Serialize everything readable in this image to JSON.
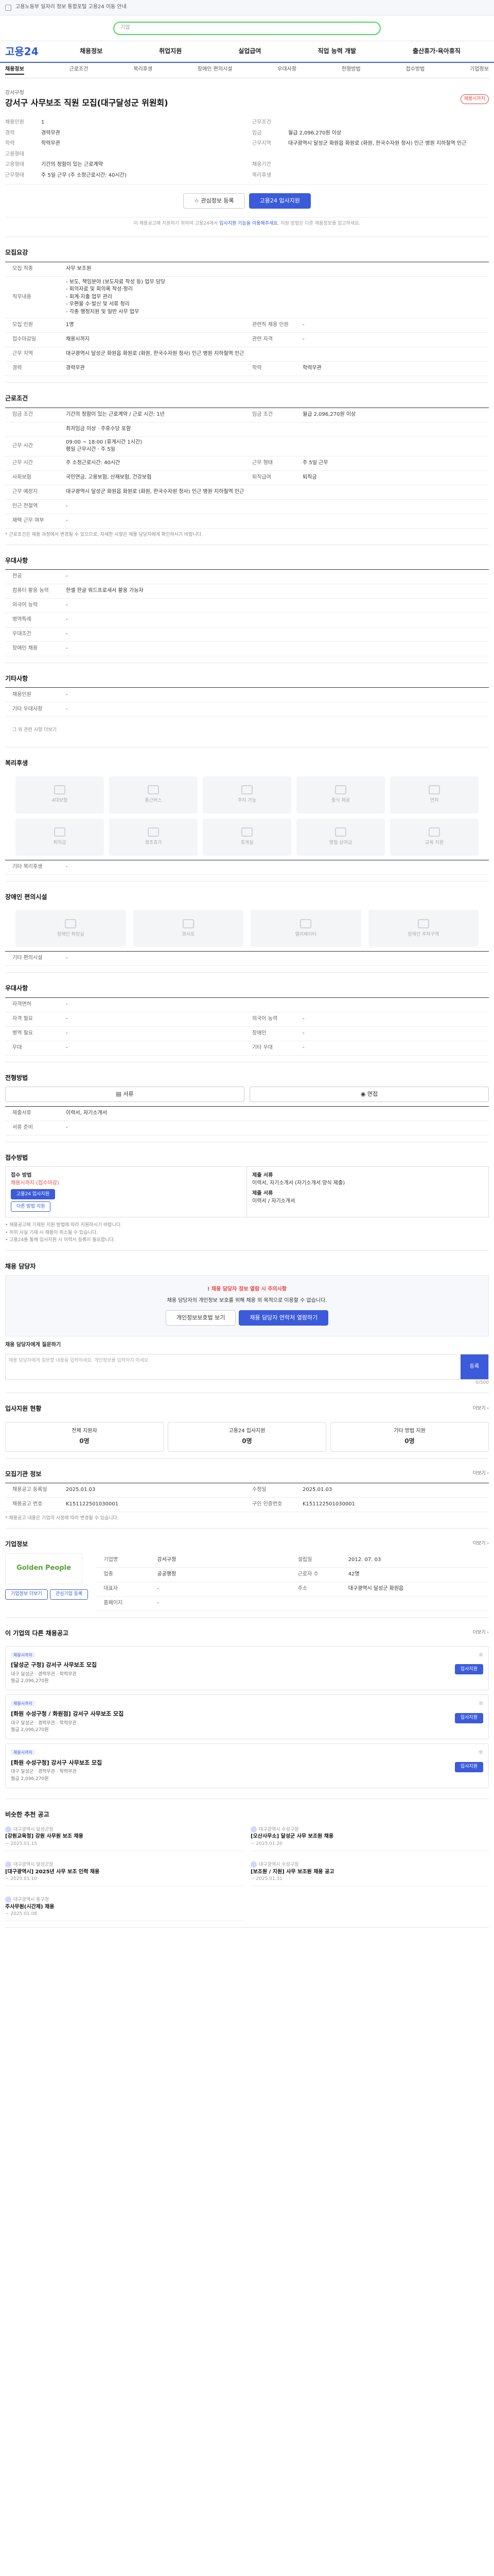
{
  "topbar": {
    "text": "고용노동부 일자리 정보 통합포털 고용24 이동 안내"
  },
  "search": {
    "placeholder": "기업"
  },
  "gnb": {
    "logo": "고용24",
    "menu": [
      "채용정보",
      "취업지원",
      "실업급여",
      "직업 능력 개발",
      "출산휴가·육아휴직"
    ]
  },
  "tabs": [
    "채용정보",
    "근로조건",
    "복리후생",
    "장애인 편의시설",
    "우대사항",
    "전형방법",
    "접수방법",
    "기업정보"
  ],
  "job": {
    "company": "강서구청",
    "title": "강서구 사무보조 직원 모집(대구달성군 위원회)",
    "badge": "채용시까지",
    "left": [
      {
        "k": "채용인원",
        "v": "1"
      },
      {
        "k": "경력",
        "v": "경력무관"
      },
      {
        "k": "학력",
        "v": "학력무관"
      },
      {
        "k": "고용형태",
        "v": ""
      },
      {
        "k": "고용형태",
        "v": "기간의 정함이 있는 근로계약"
      },
      {
        "k": "근무형태",
        "v": "주 5일 근무 (주 소정근로시간: 40시간)"
      }
    ],
    "right": [
      {
        "k": "근무조건",
        "v": ""
      },
      {
        "k": "임금",
        "v": "월급 2,096,270원 이상"
      },
      {
        "k": "근무지역",
        "v": "대구광역시 달성군 화원읍 화원로 (화원, 한국수자원 청사) 인근 병원 지하철역 인근"
      },
      {
        "k": "",
        "v": ""
      },
      {
        "k": "채용기간",
        "v": ""
      },
      {
        "k": "복리후생",
        "v": ""
      }
    ],
    "scrap_btn": "관심정보 등록",
    "apply_btn": "고용24 입사지원",
    "apply_note_pre": "이 채용공고에 지원하기 위하여 고용24에서",
    "apply_note_link": "입사지원 기능을 이용해주세요.",
    "apply_note_post": "지원 방법은 다른 채용정보를 참고하세요."
  },
  "recruit": {
    "title": "모집요강",
    "rows": [
      {
        "k": "모집 직종",
        "v": "사무 보조원"
      },
      {
        "k": "직무내용",
        "v": "- 보도, 책임분야 (보도자료 작성 등) 업무 담당\n- 회의자료 및 회의록 작성·정리\n- 회계·지출 업무 관리\n- 우편물 수·발신 및 서류 정리\n- 각종 행정지원 및 일반 사무 업무"
      },
      {
        "k": "모집 인원",
        "v": "1명",
        "k2": "관련직 채용 인원",
        "v2": "-"
      },
      {
        "k": "접수마감일",
        "v": "채용시까지",
        "k2": "관련 자격",
        "v2": "-"
      },
      {
        "k": "근무 지역",
        "v": "대구광역시 달성군 화원읍 화원로 (화원, 한국수자원 청사) 인근 병원 지하철역 인근"
      },
      {
        "k": "경력",
        "v": "경력무관",
        "k2": "학력",
        "v2": "학력무관"
      }
    ]
  },
  "conditions": {
    "title": "근로조건",
    "rows": [
      {
        "k": "임금 조건",
        "v": "기간의 정함이 있는 근로계약 / 근로 시간: 1년",
        "k2": "임금 조건",
        "v2": "월급 2,096,270원 이상"
      },
      {
        "k": "",
        "v": "최저임금 이상 · 주휴수당 포함"
      },
      {
        "k": "근무 시간",
        "v": "09:00 ~ 18:00 (휴게시간 1시간)\n평일 근무시간 · 주 5일"
      },
      {
        "k": "근무 시간",
        "v": "주 소정근로시간: 40시간",
        "k2": "근무 형태",
        "v2": "주 5일 근무"
      },
      {
        "k": "사회보험",
        "v": "국민연금, 고용보험, 산재보험, 건강보험",
        "k2": "퇴직급여",
        "v2": "퇴직금"
      },
      {
        "k": "근무 예정지",
        "v": "대구광역시 달성군 화원읍 화원로 (화원, 한국수자원 청사) 인근 병원 지하철역 인근"
      },
      {
        "k": "인근 전철역",
        "v": "-"
      },
      {
        "k": "재택 근무 여부",
        "v": "-"
      }
    ],
    "footnote": "* 근로조건은 채용 과정에서 변경될 수 있으므로, 자세한 사항은 채용 담당자에게 확인하시기 바랍니다."
  },
  "preference": {
    "title": "우대사항",
    "rows": [
      {
        "k": "전공",
        "v": "-"
      },
      {
        "k": "컴퓨터 활용 능력",
        "v": "한셀 한글 워드프로세서 활용 가능자"
      },
      {
        "k": "외국어 능력",
        "v": "-"
      },
      {
        "k": "병역특례",
        "v": "-"
      },
      {
        "k": "우대조건",
        "v": "-"
      },
      {
        "k": "장애인 채용",
        "v": "-"
      }
    ]
  },
  "others": {
    "title": "기타사항",
    "rows": [
      {
        "k": "채용인원",
        "v": "-"
      },
      {
        "k": "기타 우대사항",
        "v": "-"
      }
    ],
    "link": "그 외 관련 사항 더보기"
  },
  "welfare": {
    "title": "복리후생",
    "tiles": [
      "4대보험",
      "통근버스",
      "주차 가능",
      "중식 제공",
      "연차",
      "퇴직금",
      "경조휴가",
      "휴게실",
      "명절 상여금",
      "교육 지원"
    ],
    "other_k": "기타 복리후생",
    "other_v": "-"
  },
  "disability": {
    "title": "장애인 편의시설",
    "tiles": [
      "장애인 화장실",
      "경사로",
      "엘리베이터",
      "장애인 주차구역"
    ],
    "other_k": "기타 편의시설",
    "other_v": "-"
  },
  "extra": {
    "title": "우대사항",
    "rows": [
      {
        "k": "자격면허",
        "v": "-"
      },
      {
        "k": "자격 필요",
        "v": "-",
        "k2": "외국어 능력",
        "v2": "-"
      },
      {
        "k": "병역 필요",
        "v": "-",
        "k2": "장애인",
        "v2": "-"
      },
      {
        "k": "우대",
        "v": "-",
        "k2": "기타 우대",
        "v2": "-"
      }
    ]
  },
  "selection": {
    "title": "전형방법",
    "methods": [
      "서류",
      "면접"
    ],
    "rows": [
      {
        "k": "제출서류",
        "v": "이력서, 자기소개서"
      },
      {
        "k": "서류 준비",
        "v": "-"
      }
    ]
  },
  "application": {
    "title": "접수방법",
    "left_title": "접수 방법",
    "left_v": "채용시까지 (접수마감)",
    "left_btn1": "고용24 입사지원",
    "left_btn2": "다른 방법 지원",
    "right_title": "제출 서류",
    "right_v": "이력서, 자기소개서 (자기소개서 양식 제출)",
    "right_title2": "제출 서류",
    "right_v2": "이력서 / 자기소개서",
    "bullets": [
      "• 채용공고에 기재된 지원 방법에 따라 지원하시기 바랍니다.",
      "• 허위 사실 기재 시 채용이 취소될 수 있습니다.",
      "• 고용24를 통해 입사지원 시 이력서 등록이 필요합니다."
    ]
  },
  "qa": {
    "title": "채용 담당자",
    "warn": "! 채용 담당자 정보 열람 시 주의사항",
    "desc": "채용 담당자의 개인정보 보호를 위해 채용 외 목적으로 이용할 수 없습니다.",
    "btn1": "개인정보보호법 보기",
    "btn2": "채용 담당자 연락처 열람하기",
    "input_label": "채용 담당자에게 질문하기",
    "input_placeholder": "채용 담당자에게 질문할 내용을 입력하세요. 개인정보를 입력하지 마세요.",
    "send": "등록",
    "count": "0/500"
  },
  "status": {
    "title": "입사지원 현황",
    "more": "더보기 ›",
    "items": [
      {
        "label": "전체 지원자",
        "v": "0명"
      },
      {
        "label": "고용24 입사지원",
        "v": "0명"
      },
      {
        "label": "기타 방법 지원",
        "v": "0명"
      }
    ]
  },
  "info": {
    "title": "모집기관 정보",
    "more": "더보기 ›",
    "rows": [
      {
        "k": "채용공고 등록일",
        "v": "2025.01.03",
        "k2": "수정일",
        "v2": "2025.01.03"
      },
      {
        "k": "채용공고 번호",
        "v": "K151122501030001",
        "k2": "구인 인증번호",
        "v2": "K151122501030001"
      }
    ],
    "note": "* 채용공고 내용은 기업의 사정에 따라 변경될 수 있습니다."
  },
  "company": {
    "title": "기업정보",
    "more": "더보기 ›",
    "logo": "Golden People",
    "rows": [
      {
        "k": "기업명",
        "v": "강서구청",
        "k2": "설립일",
        "v2": "2012. 07. 03"
      },
      {
        "k": "업종",
        "v": "공공행정",
        "k2": "근로자 수",
        "v2": "42명"
      },
      {
        "k": "대표자",
        "v": "-",
        "k2": "주소",
        "v2": "대구광역시 달성군 화원읍"
      },
      {
        "k": "홈페이지",
        "v": "-",
        "k2": "",
        "v2": ""
      }
    ],
    "btn1": "기업정보 더보기",
    "btn2": "관심기업 등록"
  },
  "similar": {
    "title": "이 기업의 다른 채용공고",
    "more": "더보기 ›",
    "cards": [
      {
        "tag": "채용시까지",
        "title": "[달성군 구청] 강서구 사무보조 모집",
        "meta": "대구 달성군 · 경력무관 · 학력무관",
        "pay": "월급 2,096,270원",
        "btn": "입사지원"
      },
      {
        "tag": "채용시까지",
        "title": "[화원 수성구청 / 화원점] 강서구 사무보조 모집",
        "meta": "대구 달성군 · 경력무관 · 학력무관",
        "pay": "월급 2,096,270원",
        "btn": "입사지원"
      },
      {
        "tag": "채용시까지",
        "title": "[화원 수성구청] 강서구 사무보조 모집",
        "meta": "대구 달성군 · 경력무관 · 학력무관",
        "pay": "월급 2,096,270원",
        "btn": "입사지원"
      }
    ]
  },
  "recommend": {
    "title": "비슷한 추천 공고",
    "items": [
      {
        "co": "대구광역시 달성군청",
        "t": "[강원교육청] 강원 사무원 보조 채용",
        "meta": "~ 2025.01.15"
      },
      {
        "co": "대구광역시 수성구청",
        "t": "[오산사무소] 달성군 사무 보조원 채용",
        "meta": "~ 2025.01.20"
      },
      {
        "co": "대구광역시 달성군청",
        "t": "[대구광역시] 2025년 사무 보조 인력 채용",
        "meta": "~ 2025.01.10"
      },
      {
        "co": "대구광역시 수성구청",
        "t": "[보조원 / 지원] 사무 보조원 채용 공고",
        "meta": "~ 2025.01.31"
      },
      {
        "co": "대구광역시 동구청",
        "t": "주사무원(시간제) 채용",
        "meta": "~ 2025.01.08"
      }
    ]
  }
}
